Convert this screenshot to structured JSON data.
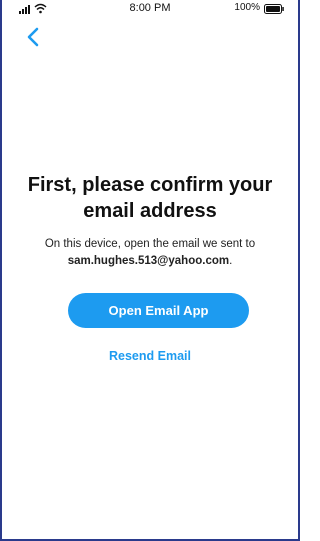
{
  "status_bar": {
    "time": "8:00 PM",
    "battery": "100%",
    "icons": [
      "signal-icon",
      "wifi-icon",
      "battery-icon"
    ]
  },
  "nav": {
    "back_icon": "chevron-left-icon"
  },
  "main": {
    "headline": "First, please confirm your email address",
    "body_prefix": "On this device, open the email we sent to",
    "email": "sam.hughes.513@yahoo.com",
    "body_suffix": ".",
    "primary_button_label": "Open Email App",
    "secondary_link_label": "Resend Email"
  },
  "colors": {
    "accent": "#1d9bf0",
    "frame_border": "#2a3a8c",
    "text": "#111111"
  }
}
